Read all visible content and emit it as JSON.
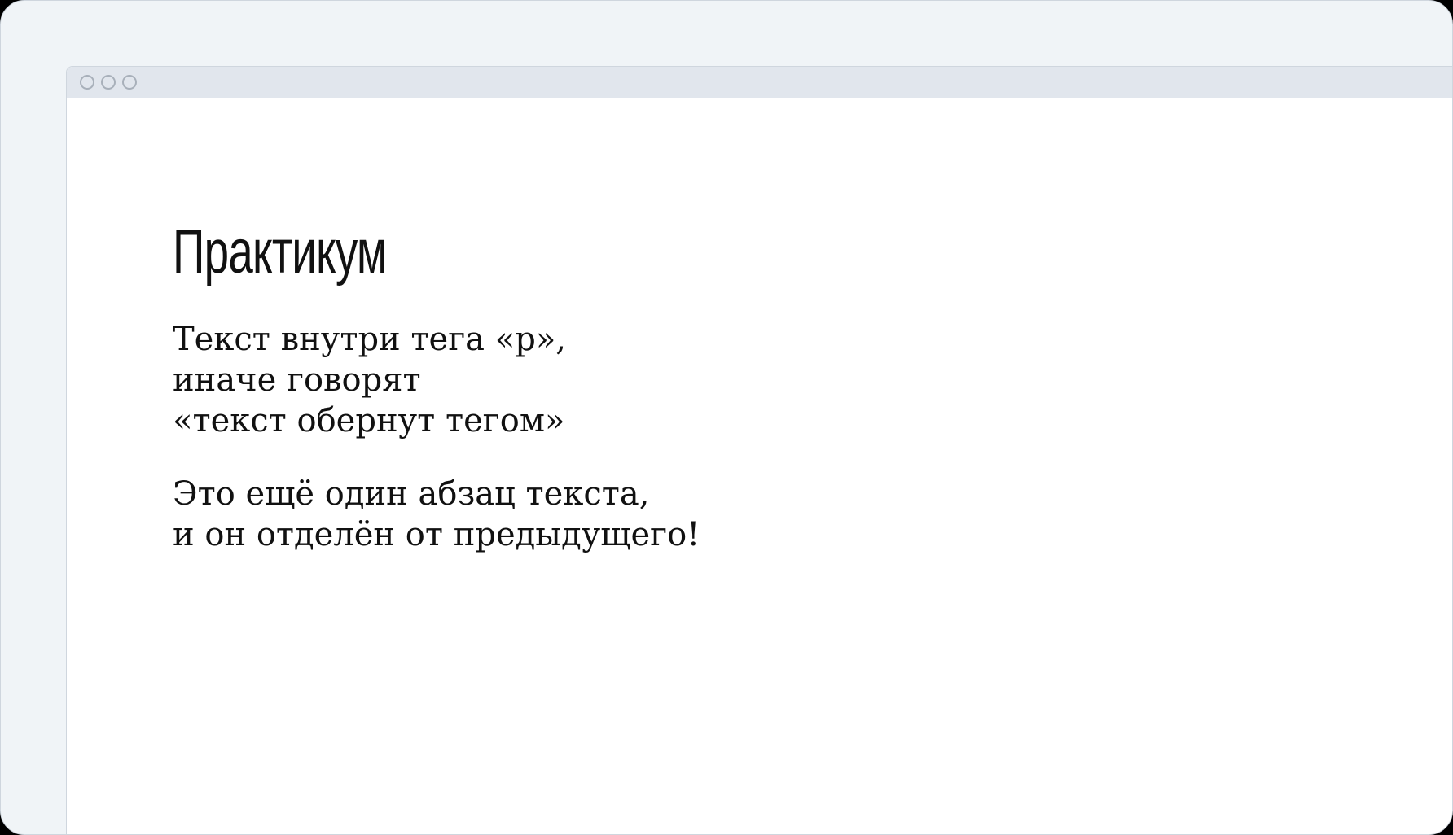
{
  "page": {
    "heading": "Практикум",
    "paragraphs": [
      {
        "lines": [
          "Текст внутри тега «p»,",
          "иначе говорят",
          "«текст обернут тегом»"
        ]
      },
      {
        "lines": [
          "Это ещё один абзац текста,",
          "и он отделён от предыдущего!"
        ]
      }
    ]
  },
  "colors": {
    "outer_background": "#f0f4f7",
    "titlebar": "#e1e6ed",
    "page_background": "#ffffff",
    "text": "#111111"
  }
}
